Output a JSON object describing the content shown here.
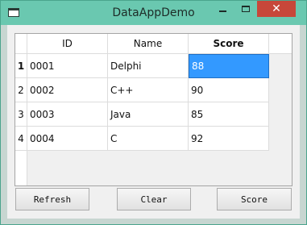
{
  "window": {
    "title": "DataAppDemo",
    "close_glyph": "✕"
  },
  "table": {
    "columns": [
      "ID",
      "Name",
      "Score"
    ],
    "row_numbers": [
      "1",
      "2",
      "3",
      "4"
    ],
    "rows": [
      [
        "0001",
        "Delphi",
        "88"
      ],
      [
        "0002",
        "C++",
        "90"
      ],
      [
        "0003",
        "Java",
        "85"
      ],
      [
        "0004",
        "C",
        "92"
      ]
    ],
    "selected_cell": {
      "row": 0,
      "column": "Score"
    }
  },
  "buttons": {
    "refresh": "Refresh",
    "clear": "Clear",
    "score": "Score"
  },
  "colors": {
    "titlebar": "#6ac8b0",
    "close_button": "#c7473a",
    "selection": "#3399ff"
  },
  "icons": {
    "app": "app-window-icon",
    "minimize": "minimize-icon",
    "maximize": "maximize-icon",
    "close": "close-icon"
  }
}
